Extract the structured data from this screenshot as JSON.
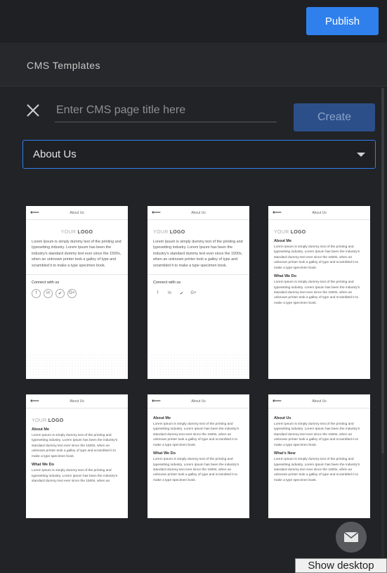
{
  "header": {
    "publish_label": "Publish"
  },
  "section": {
    "title": "CMS Templates"
  },
  "form": {
    "title_placeholder": "Enter CMS page title here",
    "title_value": "",
    "create_label": "Create",
    "template_select": "About Us"
  },
  "templates": [
    {
      "bar_title": "About Us",
      "logo_prefix": "YOUR",
      "logo_word": "LOGO",
      "paragraph": "Lorem Ipsum is simply dummy text of the printing and typesetting industry. Lorem Ipsum has been the industry's standard dummy text ever since the 1500s, when an unknown printer took a galley of type and scrambled it to make a type specimen book.",
      "connect_label": "Connect with us",
      "social_icons": [
        "f",
        "in",
        "✔",
        "G+"
      ]
    },
    {
      "bar_title": "About Us",
      "logo_prefix": "YOUR",
      "logo_word": "LOGO",
      "paragraph": "Lorem Ipsum is simply dummy text of the printing and typesetting industry. Lorem Ipsum has been the industry's standard dummy text ever since the 1500s, when an unknown printer took a galley of type and scrambled it to make a type specimen book.",
      "connect_label": "Connect with us",
      "social_icons": [
        "f",
        "in",
        "✔",
        "G+"
      ]
    },
    {
      "bar_title": "About Us",
      "logo_prefix": "YOUR",
      "logo_word": "LOGO",
      "section1_title": "About Me",
      "section1_text": "Lorem Ipsum is simply dummy text of the printing and typesetting industry. Lorem Ipsum has been the industry's standard dummy text ever since the 1500s, when an unknown printer took a galley of type and scrambled it to make a type specimen book.",
      "section2_title": "What We Do",
      "section2_text": "Lorem Ipsum is simply dummy text of the printing and typesetting industry. Lorem Ipsum has been the industry's standard dummy text ever since the 1500s, when an unknown printer took a galley of type and scrambled it to make a type specimen book."
    },
    {
      "bar_title": "About Us",
      "logo_prefix": "YOUR",
      "logo_word": "LOGO",
      "section1_title": "About Me",
      "section1_text": "Lorem Ipsum is simply dummy text of the printing and typesetting industry. Lorem Ipsum has been the industry's standard dummy text ever since the 1500s, when an unknown printer took a galley of type and scrambled it to make a type specimen book.",
      "section2_title": "What We Do",
      "section2_text": "Lorem Ipsum is simply dummy text of the printing and typesetting industry. Lorem Ipsum has been the industry's standard dummy text ever since the 1500s, when an"
    },
    {
      "bar_title": "About Us",
      "section1_title": "About Me",
      "section1_text": "Lorem Ipsum is simply dummy text of the printing and typesetting industry. Lorem Ipsum has been the industry's standard dummy text ever since the 1500s, when an unknown printer took a galley of type and scrambled it to make a type specimen book.",
      "section2_title": "What We Do",
      "section2_text": "Lorem Ipsum is simply dummy text of the printing and typesetting industry. Lorem Ipsum has been the industry's standard dummy text ever since the 1500s, when an unknown printer took a galley of type and scrambled it to make a type specimen book."
    },
    {
      "bar_title": "About Us",
      "section1_title": "About Us",
      "section1_text": "Lorem Ipsum is simply dummy text of the printing and typesetting industry. Lorem Ipsum has been the industry's standard dummy text ever since the 1500s, when an unknown printer took a galley of type and scrambled it to make a type specimen book.",
      "section2_title": "What's New",
      "section2_text": "Lorem Ipsum is simply dummy text of the printing and typesetting industry. Lorem Ipsum has been the industry's standard dummy text ever since the 1500s, when an unknown printer took a galley of type and scrambled it to make a type specimen book."
    }
  ],
  "chat": {
    "icon": "mail-icon"
  },
  "tooltip": {
    "text": "Show desktop"
  }
}
